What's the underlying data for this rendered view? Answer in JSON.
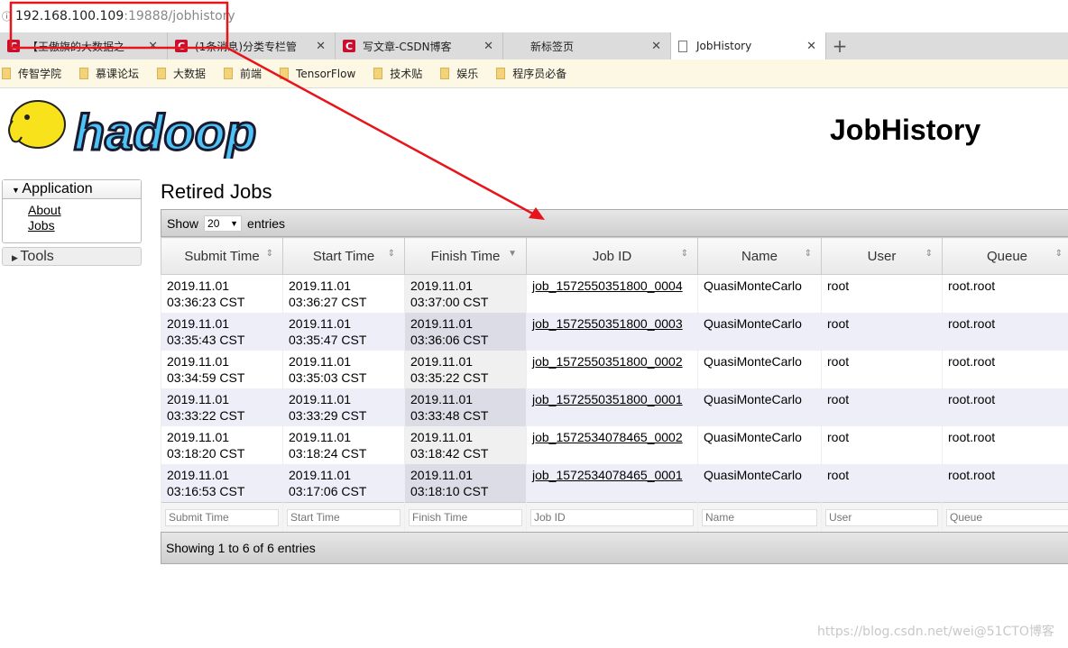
{
  "browser": {
    "url_host": "192.168.100.109",
    "url_rest": ":19888/jobhistory",
    "tabs": [
      {
        "title": "【王傲旗的大数据之",
        "icon": "csdn-icon"
      },
      {
        "title": "(1条消息)分类专栏管",
        "icon": "csdn-icon"
      },
      {
        "title": "写文章-CSDN博客",
        "icon": "csdn-icon"
      },
      {
        "title": "新标签页",
        "icon": "none"
      },
      {
        "title": "JobHistory",
        "icon": "document-icon",
        "active": true
      }
    ],
    "bookmarks": [
      "传智学院",
      "慕课论坛",
      "大数据",
      "前端",
      "TensorFlow",
      "技术贴",
      "娱乐",
      "程序员必备"
    ]
  },
  "header": {
    "logo": "hadoop",
    "title": "JobHistory"
  },
  "nav": {
    "application": "Application",
    "links": [
      "About",
      "Jobs"
    ],
    "tools": "Tools"
  },
  "main": {
    "title": "Retired Jobs",
    "show_label": "Show",
    "page_size": "20",
    "entries_label": "entries",
    "columns": [
      "Submit Time",
      "Start Time",
      "Finish Time",
      "Job ID",
      "Name",
      "User",
      "Queue"
    ],
    "rows": [
      [
        "2019.11.01 03:36:23 CST",
        "2019.11.01 03:36:27 CST",
        "2019.11.01 03:37:00 CST",
        "job_1572550351800_0004",
        "QuasiMonteCarlo",
        "root",
        "root.root"
      ],
      [
        "2019.11.01 03:35:43 CST",
        "2019.11.01 03:35:47 CST",
        "2019.11.01 03:36:06 CST",
        "job_1572550351800_0003",
        "QuasiMonteCarlo",
        "root",
        "root.root"
      ],
      [
        "2019.11.01 03:34:59 CST",
        "2019.11.01 03:35:03 CST",
        "2019.11.01 03:35:22 CST",
        "job_1572550351800_0002",
        "QuasiMonteCarlo",
        "root",
        "root.root"
      ],
      [
        "2019.11.01 03:33:22 CST",
        "2019.11.01 03:33:29 CST",
        "2019.11.01 03:33:48 CST",
        "job_1572550351800_0001",
        "QuasiMonteCarlo",
        "root",
        "root.root"
      ],
      [
        "2019.11.01 03:18:20 CST",
        "2019.11.01 03:18:24 CST",
        "2019.11.01 03:18:42 CST",
        "job_1572534078465_0002",
        "QuasiMonteCarlo",
        "root",
        "root.root"
      ],
      [
        "2019.11.01 03:16:53 CST",
        "2019.11.01 03:17:06 CST",
        "2019.11.01 03:18:10 CST",
        "job_1572534078465_0001",
        "QuasiMonteCarlo",
        "root",
        "root.root"
      ]
    ],
    "footer": "Showing 1 to 6 of 6 entries"
  },
  "watermark": "https://blog.csdn.net/wei@51CTO博客",
  "colors": {
    "annotation": "#e8141c",
    "csdn": "#c8102e"
  }
}
